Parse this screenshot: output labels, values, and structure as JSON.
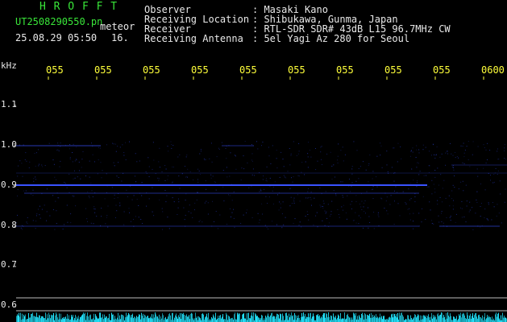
{
  "header": {
    "title": "H R O F F T",
    "filename": "UT2508290550.pn",
    "meteor_label": "meteor",
    "datetime": "25.08.29 05:50",
    "count": "16.",
    "fields": [
      {
        "label": "Observer",
        "value": ": Masaki Kano"
      },
      {
        "label": "Receiving Location",
        "value": ": Shibukawa, Gunma, Japan"
      },
      {
        "label": "Receiver",
        "value": ": RTL-SDR SDR# 43dB L15 96.7MHz CW"
      },
      {
        "label": "Receiving Antenna",
        "value": ": 5el Yagi Az 280 for Seoul"
      }
    ]
  },
  "axes": {
    "y_unit": "kHz",
    "y_ticks": [
      "1.1",
      "1.0",
      "0.9",
      "0.8",
      "0.7",
      "0.6"
    ],
    "time_ticks": [
      "055",
      "055",
      "055",
      "055",
      "055",
      "055",
      "055",
      "055",
      "055",
      "0600"
    ]
  },
  "colors": {
    "bg": "#000000",
    "header_green": "#39e639",
    "header_white": "#e8e8e8",
    "time_yellow": "#ffff3a",
    "signal_blue": "#3a52ff",
    "noise_cyan": "#22e6ff"
  }
}
